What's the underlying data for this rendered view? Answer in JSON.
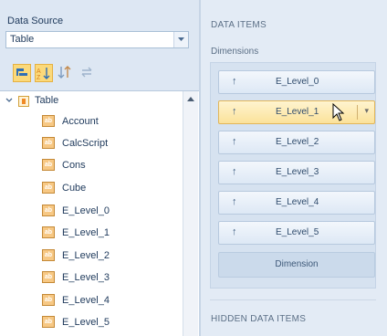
{
  "left": {
    "data_source_label": "Data Source",
    "data_source_value": "Table",
    "toolbar": {
      "buttons": [
        "group-by-type-icon",
        "sort-ascending-icon",
        "sort-descending-icon",
        "refresh-icon"
      ],
      "active_index": 0
    },
    "tree": {
      "root_label": "Table",
      "items": [
        "Account",
        "CalcScript",
        "Cons",
        "Cube",
        "E_Level_0",
        "E_Level_1",
        "E_Level_2",
        "E_Level_3",
        "E_Level_4",
        "E_Level_5"
      ],
      "item_icon_text": "ab"
    }
  },
  "right": {
    "data_items_title": "DATA ITEMS",
    "dimensions_label": "Dimensions",
    "dimensions": [
      {
        "label": "E_Level_0",
        "arrow": "↑"
      },
      {
        "label": "E_Level_1",
        "arrow": "↑",
        "hover": true
      },
      {
        "label": "E_Level_2",
        "arrow": "↑"
      },
      {
        "label": "E_Level_3",
        "arrow": "↑"
      },
      {
        "label": "E_Level_4",
        "arrow": "↑"
      },
      {
        "label": "E_Level_5",
        "arrow": "↑"
      }
    ],
    "dimension_placeholder": "Dimension",
    "hidden_data_items_title": "HIDDEN DATA ITEMS"
  },
  "colors": {
    "accent_hover": "#fbe29a",
    "active_tool": "#fbd97a",
    "field_icon": "#f7c884"
  }
}
